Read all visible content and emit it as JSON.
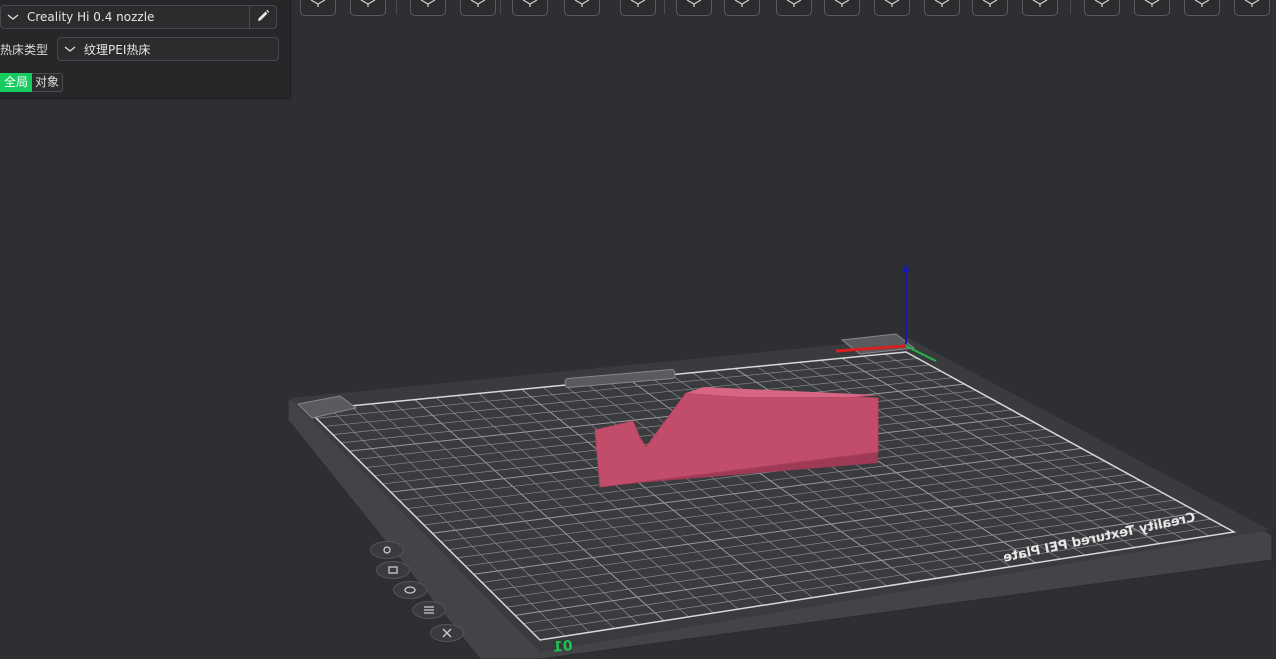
{
  "printer": {
    "name": "Creality Hi 0.4 nozzle",
    "edit_icon": "pencil-icon"
  },
  "bed": {
    "label": "热床类型",
    "value": "纹理PEI热床"
  },
  "scope_toggle": {
    "global_label": "全局",
    "object_label": "对象"
  },
  "viewport": {
    "plate_label": "Creality Textured PEI Plate",
    "plate_number": "01",
    "model_color": "#c24d6a",
    "axis_colors": {
      "x": "#d42020",
      "y": "#1fb84a",
      "z": "#1a1aa8"
    }
  },
  "toolbar_icons": [
    "cube-view-icon",
    "grid-icon",
    "add-plate-icon",
    "orient-icon",
    "auto-arrange-icon",
    "layout-icon",
    "split-icon",
    "boolean-icon",
    "settings-icon",
    "scale-icon",
    "cut-icon",
    "measure-icon",
    "support-paint-icon",
    "seam-paint-icon",
    "text-icon",
    "layers-icon",
    "assembly-icon",
    "hollow-icon",
    "menu-icon",
    "globe-icon"
  ],
  "view_controls": [
    "reset-view-icon",
    "camera-icon",
    "eye-icon",
    "list-icon",
    "close-icon"
  ]
}
